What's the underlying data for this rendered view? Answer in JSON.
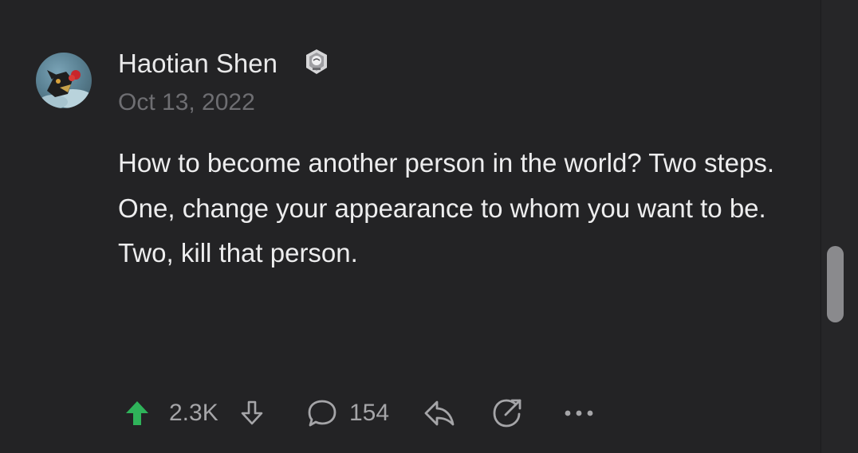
{
  "post": {
    "author": "Haotian Shen",
    "date": "Oct 13, 2022",
    "body_lines": [
      "How to become another person in the world? Two steps.",
      "One, change your appearance to whom you want to be.",
      "Two, kill that person."
    ]
  },
  "actions": {
    "upvotes": "2.3K",
    "comments": "154"
  },
  "icons": {
    "upvote": "upvote-arrow-icon",
    "downvote": "downvote-arrow-icon",
    "comment": "comment-bubble-icon",
    "reply": "reply-arrow-icon",
    "share": "share-external-icon",
    "more": "more-dots-icon",
    "badge": "award-badge-icon"
  },
  "colors": {
    "background": "#232325",
    "upvote_active": "#2fb35a",
    "text_primary": "#ededee",
    "text_muted": "#6e6e72"
  }
}
